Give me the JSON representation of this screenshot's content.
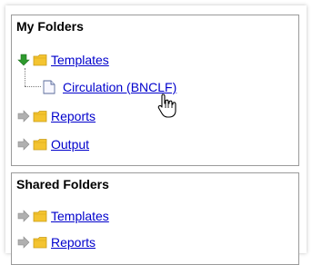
{
  "my_folders": {
    "title": "My Folders",
    "items": [
      {
        "label": "Templates",
        "expanded": true,
        "arrow_color": "#2e9a2e",
        "children": [
          {
            "label": "Circulation (BNCLF)"
          }
        ]
      },
      {
        "label": "Reports",
        "expanded": false,
        "arrow_color": "#9a9a9a"
      },
      {
        "label": "Output",
        "expanded": false,
        "arrow_color": "#9a9a9a"
      }
    ]
  },
  "shared_folders": {
    "title": "Shared Folders",
    "items": [
      {
        "label": "Templates",
        "expanded": false,
        "arrow_color": "#9a9a9a"
      },
      {
        "label": "Reports",
        "expanded": false,
        "arrow_color": "#9a9a9a"
      }
    ]
  },
  "colors": {
    "link": "#0000cc",
    "folder": "#f4c430",
    "border": "#9a9a9a"
  }
}
